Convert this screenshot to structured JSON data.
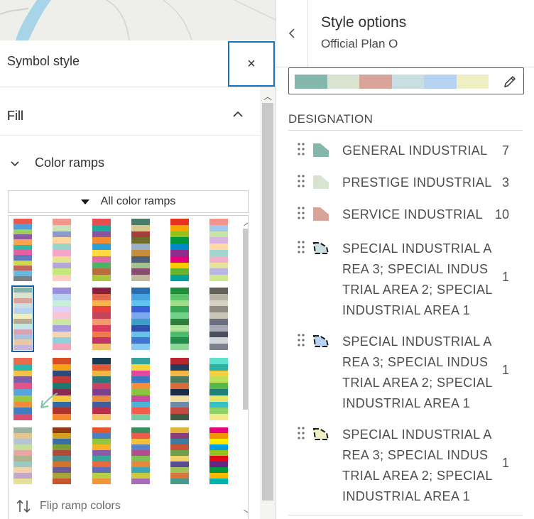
{
  "symbol_style": {
    "title": "Symbol style",
    "close_glyph": "×",
    "fill_label": "Fill",
    "color_ramps_label": "Color ramps",
    "ramp_filter": "All color ramps",
    "flip_label": "Flip ramp colors",
    "ramps": [
      [
        "#e8584f",
        "#4fa0d8",
        "#9ed15c",
        "#8f5ba6",
        "#f7a54a",
        "#37b6a6",
        "#e55fa2",
        "#5f7ab8",
        "#cfd94b",
        "#c1665b",
        "#6ab8e1",
        "#80807f"
      ],
      [
        "#f1978e",
        "#c9e4b7",
        "#8d9bc9",
        "#ffd6a0",
        "#9ad3c9",
        "#f5a6c8",
        "#e6e38f",
        "#b5a8d4",
        "#c5ea7b",
        "#fbd0bf"
      ],
      [
        "#e64f4f",
        "#1fa99d",
        "#8755a2",
        "#f48d2f",
        "#2c9fd9",
        "#ffd93f",
        "#e46aa7",
        "#4eb266",
        "#b86d3e",
        "#a8c73c"
      ],
      [
        "#4a7c6b",
        "#d7c98a",
        "#a83d3d",
        "#6d6d2c",
        "#9ab1c9",
        "#c58d3c",
        "#4f607d",
        "#a3c28d",
        "#8a4c71",
        "#c2b89c"
      ],
      [
        "#e6321e",
        "#f6a800",
        "#95c11f",
        "#009640",
        "#008ac9",
        "#8d2c89",
        "#e2007a",
        "#fcc900",
        "#65b32e",
        "#00a19a"
      ],
      [
        "#f5928c",
        "#a1c9ee",
        "#c8e5a8",
        "#d8b6e1",
        "#ffd8a6",
        "#9fd6d0",
        "#f3b0c9",
        "#e6e49a",
        "#b9b6e2",
        "#cfe88e"
      ],
      [
        "#85b6ad",
        "#d8e4cf",
        "#d9a59a",
        "#c9dee3",
        "#b6d4f1",
        "#f0efc3",
        "#b9a98f",
        "#c5e6e3",
        "#d5a4b5",
        "#a9c1e2",
        "#e7c9a9",
        "#c7b6da"
      ],
      [
        "#9b8ede",
        "#bcd2f1",
        "#c7f0d8",
        "#dfd1f7",
        "#f6c5d1",
        "#cbe7a4",
        "#a89fe0",
        "#f3d6b4",
        "#8fd0dc",
        "#f2a6bb"
      ],
      [
        "#8c1f3e",
        "#e06a4c",
        "#f7b44c",
        "#e83f3f",
        "#c4455b",
        "#f59a6a",
        "#db3d5c",
        "#ee7c4a",
        "#c2356c",
        "#f4bd6a"
      ],
      [
        "#2b6cb0",
        "#49a3e3",
        "#5ec4ef",
        "#3b5fd6",
        "#7da7f1",
        "#3aa0c6",
        "#2c50a8",
        "#6ac1e8",
        "#4175d3",
        "#89c9f0"
      ],
      [
        "#1f8f3c",
        "#5cc46a",
        "#9fdc8a",
        "#38a857",
        "#6fd18a",
        "#2e7d3d",
        "#aee59a",
        "#4fbb6d",
        "#218b4a",
        "#8cd69a"
      ],
      [
        "#63625a",
        "#b6b2a4",
        "#d6d2c3",
        "#8f8c81",
        "#c9c5b7",
        "#6c6f7f",
        "#a8a9b6",
        "#4c4e5d",
        "#d3d5dd",
        "#7d808d"
      ],
      [
        "#e86b4e",
        "#2cb5a8",
        "#f3c343",
        "#7e5fa6",
        "#e45387",
        "#5aa4db",
        "#9bc944",
        "#f08c3a",
        "#3f7fc1",
        "#d94f72"
      ],
      [
        "#d64e24",
        "#f4a31b",
        "#2a4b7c",
        "#c23a3a",
        "#1b7b6e",
        "#8a2b52",
        "#f6c942",
        "#2f6aa3",
        "#b0332c",
        "#f5882d"
      ],
      [
        "#193b53",
        "#e05a35",
        "#f3b541",
        "#2a7a7a",
        "#c74462",
        "#7c3f8a",
        "#e88b3e",
        "#3f5d9a",
        "#bb2e4c",
        "#f5c563"
      ],
      [
        "#35a39b",
        "#f6d43a",
        "#e4479e",
        "#3c79c4",
        "#f58e3c",
        "#8bc43f",
        "#c94a9c",
        "#48b5d6",
        "#f45d4c",
        "#77c9a5"
      ],
      [
        "#b8262e",
        "#253c5c",
        "#f2b746",
        "#4c7a5e",
        "#d96b3a",
        "#1a2b45",
        "#f6dea0",
        "#6d8aa8",
        "#c24a43",
        "#3d5a43"
      ],
      [
        "#5ee0ce",
        "#2cb1a5",
        "#f4d03f",
        "#c0e05a",
        "#58b84a",
        "#21807a",
        "#e9e56a",
        "#36c0c7",
        "#8ed36a",
        "#f3ea8a"
      ],
      [
        "#97b4a0",
        "#e5c68c",
        "#b7c3d9",
        "#c5e09a",
        "#e8a7a3",
        "#b0b48e",
        "#9dc9c4",
        "#f1d1a8",
        "#c2a7c9",
        "#e6e09a"
      ],
      [
        "#8f3a14",
        "#d1a024",
        "#3a6ea5",
        "#7a9f3a",
        "#b04a3a",
        "#4e8f8c",
        "#d0742b",
        "#6b5a9a",
        "#a8a43a",
        "#c7562c"
      ],
      [
        "#e4542d",
        "#4b7fc2",
        "#93c83e",
        "#f7b328",
        "#8b5aa8",
        "#39a79c",
        "#e8683f",
        "#5e6fb8",
        "#b8cf48",
        "#f0963a"
      ],
      [
        "#3a8f5e",
        "#f05c4c",
        "#f3c13a",
        "#5b84c4",
        "#b54c8f",
        "#7cc158",
        "#e8873c",
        "#3fa5b8",
        "#c9cb3c",
        "#a86bb5"
      ],
      [
        "#e0b33a",
        "#8b3f7a",
        "#3c7c9f",
        "#c9523a",
        "#6ea04b",
        "#f0d46a",
        "#5a4a8f",
        "#9fc25a",
        "#d8763e",
        "#4a9a8c"
      ],
      [
        "#e6007e",
        "#f39200",
        "#ffed00",
        "#00a0e3",
        "#95c11f",
        "#e30613",
        "#662483",
        "#009640",
        "#fbba00",
        "#00b5ad"
      ]
    ],
    "selected_ramp_index": 6
  },
  "style_options": {
    "title": "Style options",
    "subtitle": "Official Plan O",
    "ramp_preview_colors": [
      "#85b6ad",
      "#d8e4cf",
      "#d9a59a",
      "#c9dee3",
      "#b6d4f1",
      "#f0efc3"
    ],
    "field_label": "DESIGNATION",
    "classes": [
      {
        "label": "GENERAL INDUSTRIAL",
        "count": "7",
        "color": "#85b6ad",
        "shape": "polygon"
      },
      {
        "label": "PRESTIGE INDUSTRIAL",
        "count": "3",
        "color": "#d8e4cf",
        "shape": "polygon"
      },
      {
        "label": "SERVICE INDUSTRIAL",
        "count": "10",
        "color": "#d9a59a",
        "shape": "polygon"
      },
      {
        "label": "SPECIAL INDUSTRIAL AREA 3; SPECIAL INDUSTRIAL AREA 2; SPECIAL INDUSTRIAL AREA 1",
        "count": "1",
        "color": "#c9dee3",
        "shape": "outline"
      },
      {
        "label": "SPECIAL INDUSTRIAL AREA 3; SPECIAL INDUSTRIAL AREA 2; SPECIAL INDUSTRIAL AREA 1",
        "count": "1",
        "color": "#b6d4f1",
        "shape": "outline"
      },
      {
        "label": "SPECIAL INDUSTRIAL AREA 3; SPECIAL INDUSTRIAL AREA 2; SPECIAL INDUSTRIAL AREA 1",
        "count": "1",
        "color": "#f0efc3",
        "shape": "outline"
      }
    ]
  },
  "icons": {
    "back": "chevron-left-icon",
    "close": "close-icon",
    "fill_toggle": "chevron-up-icon",
    "color_ramps_toggle": "chevron-down-icon",
    "ramp_filter": "caret-down-icon",
    "flip": "flip-arrows-icon",
    "edit": "pencil-icon",
    "drag": "drag-handle-icon"
  },
  "colors": {
    "accent": "#1a73b8",
    "selection": "#1a5f99"
  }
}
